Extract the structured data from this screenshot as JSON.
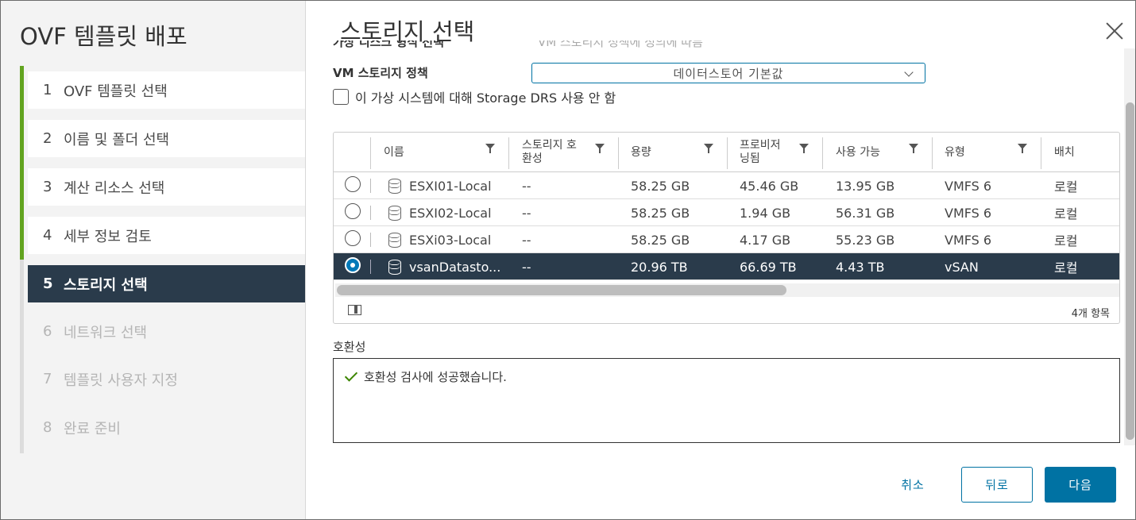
{
  "wizard": {
    "title": "OVF 템플릿 배포",
    "steps": [
      {
        "num": "1",
        "label": "OVF 템플릿 선택"
      },
      {
        "num": "2",
        "label": "이름 및 폴더 선택"
      },
      {
        "num": "3",
        "label": "계산 리소스 선택"
      },
      {
        "num": "4",
        "label": "세부 정보 검토"
      },
      {
        "num": "5",
        "label": "스토리지 선택"
      },
      {
        "num": "6",
        "label": "네트워크 선택"
      },
      {
        "num": "7",
        "label": "템플릿 사용자 지정"
      },
      {
        "num": "8",
        "label": "완료 준비"
      }
    ]
  },
  "page": {
    "title": "스토리지 선택",
    "clipped_label": "가상 디스크 형식 선택",
    "clipped_value": "VM 스토리지 정책에 정의에 따름",
    "policy_label": "VM 스토리지 정책",
    "policy_value": "데이터스토어 기본값",
    "drs_label": "이 가상 시스템에 대해 Storage DRS 사용 안 함"
  },
  "grid": {
    "headers": {
      "name": "이름",
      "compat_1": "스토리지 호",
      "compat_2": "환성",
      "capacity": "용량",
      "prov_1": "프로비저",
      "prov_2": "닝됨",
      "free": "사용 가능",
      "type": "유형",
      "placement": "배치"
    },
    "rows": [
      {
        "name": "ESXI01-Local",
        "compat": "--",
        "capacity": "58.25 GB",
        "provisioned": "45.46 GB",
        "free": "13.95 GB",
        "type": "VMFS 6",
        "placement": "로컬",
        "selected": false
      },
      {
        "name": "ESXI02-Local",
        "compat": "--",
        "capacity": "58.25 GB",
        "provisioned": "1.94 GB",
        "free": "56.31 GB",
        "type": "VMFS 6",
        "placement": "로컬",
        "selected": false
      },
      {
        "name": "ESXi03-Local",
        "compat": "--",
        "capacity": "58.25 GB",
        "provisioned": "4.17 GB",
        "free": "55.23 GB",
        "type": "VMFS 6",
        "placement": "로컬",
        "selected": false
      },
      {
        "name": "vsanDatasto...",
        "compat": "--",
        "capacity": "20.96 TB",
        "provisioned": "66.69 TB",
        "free": "4.43 TB",
        "type": "vSAN",
        "placement": "로컬",
        "selected": true
      }
    ],
    "count": "4개 항목"
  },
  "compat": {
    "label": "호환성",
    "message": "호환성 검사에 성공했습니다."
  },
  "buttons": {
    "cancel": "취소",
    "back": "뒤로",
    "next": "다음"
  },
  "colors": {
    "accent": "#0072a3",
    "completed_step": "#62a420",
    "active_step_bg": "#2a3b4b"
  }
}
